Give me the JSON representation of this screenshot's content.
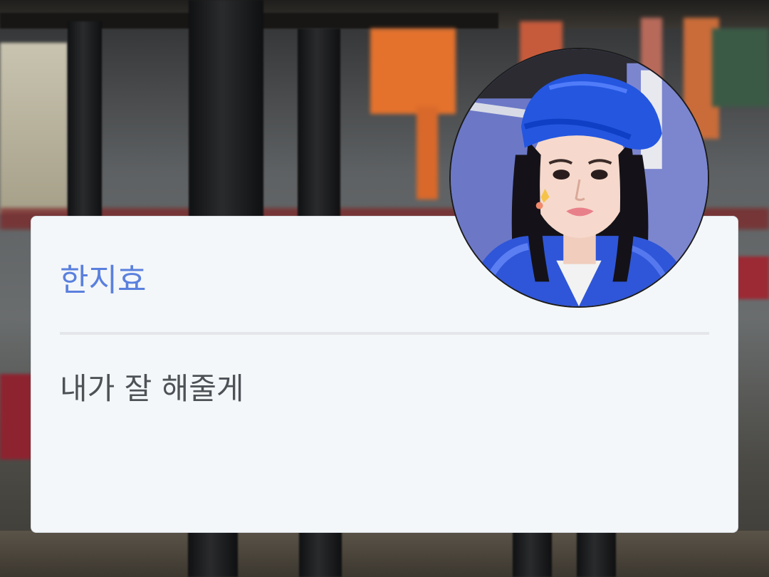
{
  "dialog": {
    "speaker_name": "한지효",
    "message": "내가 잘 해줄게"
  },
  "avatar": {
    "icon": "character-portrait"
  },
  "colors": {
    "name_accent": "#5a80de",
    "card_background": "#f4f7f9",
    "message_text": "#4d5257"
  }
}
